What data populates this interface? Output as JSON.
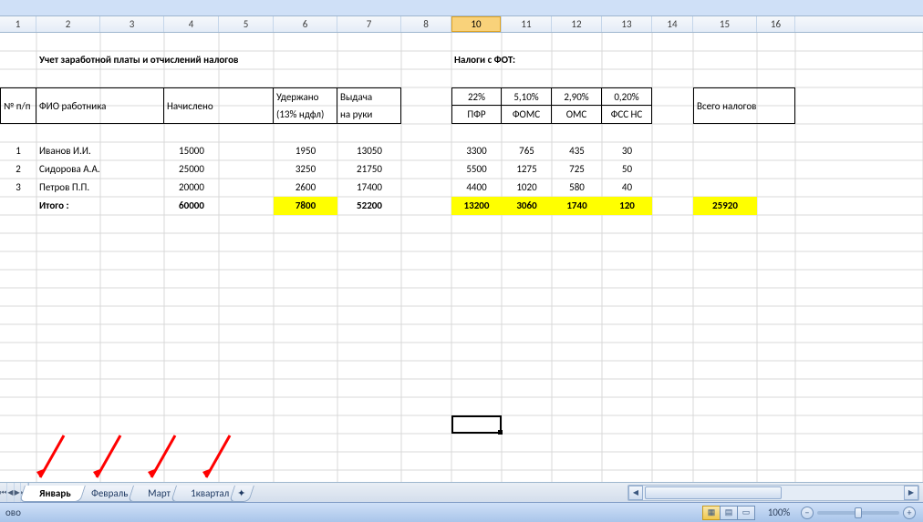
{
  "columns": {
    "widths": [
      40,
      70,
      70,
      60,
      60,
      70,
      70,
      55,
      55,
      55,
      55,
      55,
      55,
      45,
      70,
      42
    ],
    "labels": [
      "1",
      "2",
      "3",
      "4",
      "5",
      "6",
      "7",
      "8",
      "10",
      "11",
      "12",
      "13",
      "14",
      "15",
      "16"
    ],
    "active_index": 8
  },
  "sheet": {
    "title": "Учет заработной платы и отчислений налогов",
    "tax_title": "Налоги с ФОТ:",
    "headers": {
      "npp": "№ п/п",
      "fio": "ФИО работника",
      "accrued": "Начислено",
      "withheld": "Удержано",
      "withheld_sub": "(13% ндфл)",
      "payout": "Выдача",
      "payout_sub": "на руки",
      "total_taxes": "Всего налогов"
    },
    "tax_cols": {
      "percents": [
        "22%",
        "5,10%",
        "2,90%",
        "0,20%"
      ],
      "labels": [
        "ПФР",
        "ФОМС",
        "ОМС",
        "ФСС НС"
      ]
    },
    "rows": [
      {
        "n": "1",
        "fio": "Иванов И.И.",
        "accrued": "15000",
        "withheld": "1950",
        "payout": "13050",
        "taxes": [
          "3300",
          "765",
          "435",
          "30"
        ]
      },
      {
        "n": "2",
        "fio": "Сидорова А.А.",
        "accrued": "25000",
        "withheld": "3250",
        "payout": "21750",
        "taxes": [
          "5500",
          "1275",
          "725",
          "50"
        ]
      },
      {
        "n": "3",
        "fio": "Петров П.П.",
        "accrued": "20000",
        "withheld": "2600",
        "payout": "17400",
        "taxes": [
          "4400",
          "1020",
          "580",
          "40"
        ]
      }
    ],
    "totals": {
      "label": "Итого :",
      "accrued": "60000",
      "withheld": "7800",
      "payout": "52200",
      "taxes": [
        "13200",
        "3060",
        "1740",
        "120"
      ],
      "total_taxes": "25920"
    }
  },
  "tabs": {
    "items": [
      "Январь",
      "Февраль",
      "Март",
      "1квартал"
    ],
    "active": 0
  },
  "status": {
    "left": "ово",
    "zoom": "100%"
  },
  "icons": {
    "first": "⏮",
    "prev": "◀",
    "next": "▶",
    "last": "⏭",
    "normal": "▦",
    "layout": "▤",
    "break": "▭",
    "minus": "−",
    "plus": "+",
    "newtab": "✦"
  }
}
